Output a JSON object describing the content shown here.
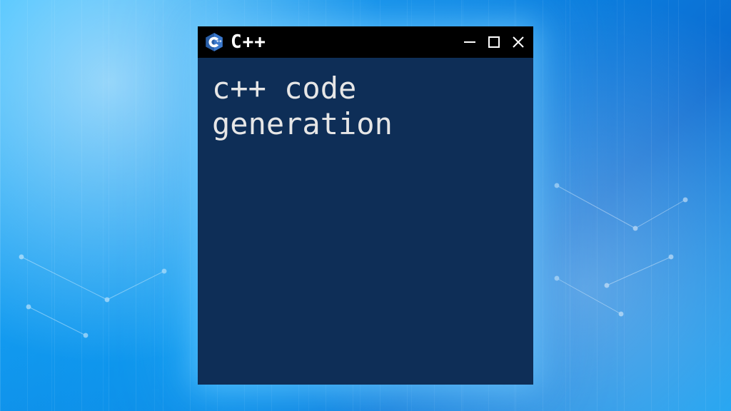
{
  "window": {
    "title": "C++",
    "icon_name": "cpp-hex-icon",
    "controls": {
      "minimize": "minimize",
      "maximize": "maximize",
      "close": "close"
    }
  },
  "content": {
    "text": "c++ code\ngeneration"
  },
  "colors": {
    "accent_bg": "#0e2e57",
    "titlebar_bg": "#000000",
    "text": "#e6e6e6"
  }
}
